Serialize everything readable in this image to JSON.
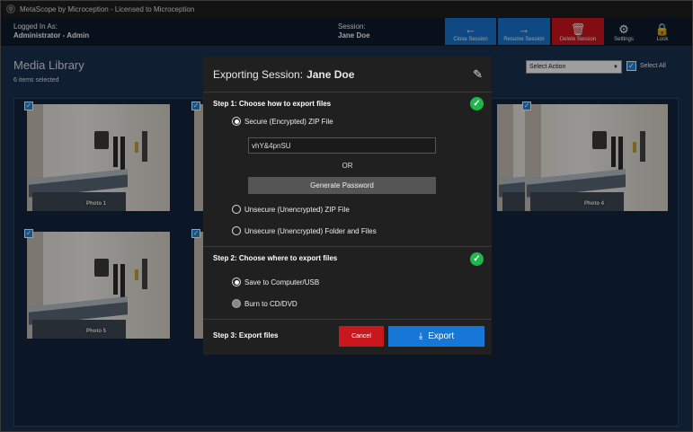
{
  "titlebar": {
    "icon": "app-icon",
    "title": "MetaScope by Microception - Licensed to Microception"
  },
  "header": {
    "logged_in_label": "Logged In As:",
    "logged_in_user": "Administrator - Admin",
    "session_label": "Session:",
    "session_name": "Jane Doe",
    "buttons": [
      {
        "label": "Close Session",
        "icon": "arrow-left-icon",
        "color": "#1777d6"
      },
      {
        "label": "Resume Session",
        "icon": "arrow-right-icon",
        "color": "#1777d6"
      },
      {
        "label": "Delete Session",
        "icon": "trash-icon",
        "color": "#d0151e"
      },
      {
        "label": "Settings",
        "icon": "gear-icon"
      },
      {
        "label": "Lock",
        "icon": "lock-icon"
      }
    ]
  },
  "library": {
    "title": "Media Library",
    "subtitle": "6 items selected",
    "action_select": "Select Action",
    "select_all": "Select All",
    "photos": [
      {
        "label": "Photo 1"
      },
      {
        "label": ""
      },
      {
        "label": ""
      },
      {
        "label": "Photo 4"
      },
      {
        "label": "Photo 5"
      },
      {
        "label": ""
      }
    ]
  },
  "modal": {
    "title_prefix": "Exporting Session:",
    "title_name": "Jane Doe",
    "step1": {
      "label": "Step 1: Choose how to export files",
      "options": [
        "Secure (Encrypted) ZIP File",
        "Unsecure (Unencrypted) ZIP File",
        "Unsecure (Unencrypted) Folder and Files"
      ],
      "selected": 0,
      "password": "vhY&4pnSU",
      "or": "OR",
      "generate_label": "Generate Password"
    },
    "step2": {
      "label": "Step 2: Choose where to export files",
      "options": [
        "Save to Computer/USB",
        "Burn to CD/DVD"
      ],
      "selected": 0
    },
    "step3": {
      "label": "Step 3: Export files",
      "cancel_label": "Cancel",
      "export_label": "Export"
    },
    "colors": {
      "accent": "#1777d6",
      "danger": "#c9171e",
      "success": "#1cb84a"
    }
  }
}
